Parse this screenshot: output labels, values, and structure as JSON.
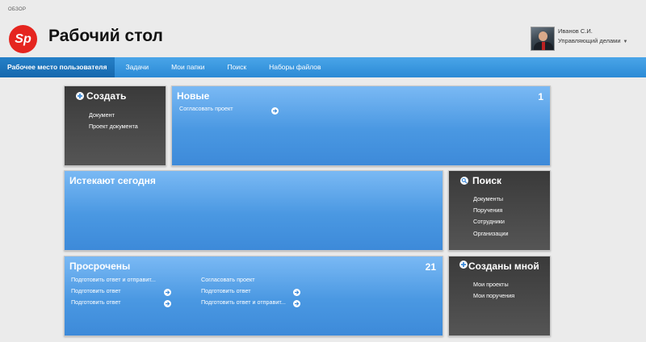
{
  "breadcrumb": "ОБЗОР",
  "logo_text": "Sp",
  "page_title": "Рабочий стол",
  "user": {
    "name": "Иванов С.И.",
    "role": "Управляющий делами"
  },
  "nav": [
    "Рабочее место пользователя",
    "Задачи",
    "Мои папки",
    "Поиск",
    "Наборы файлов"
  ],
  "create": {
    "title": "Создать",
    "items": [
      "Документ",
      "Проект документа"
    ]
  },
  "new_tasks": {
    "title": "Новые",
    "count": "1",
    "items": [
      "Согласовать проект"
    ]
  },
  "expiring": {
    "title": "Истекают сегодня"
  },
  "search": {
    "title": "Поиск",
    "items": [
      "Документы",
      "Поручения",
      "Сотрудники",
      "Организации"
    ]
  },
  "overdue": {
    "title": "Просрочены",
    "count": "21",
    "col1": [
      "Подготовить ответ и отправит...",
      "Подготовить ответ",
      "Подготовить ответ"
    ],
    "col2": [
      "Согласовать проект",
      "Подготовить ответ",
      "Подготовить ответ и отправит..."
    ]
  },
  "created_by_me": {
    "title": "Созданы мной",
    "items": [
      "Мои проекты",
      "Мои поручения"
    ]
  },
  "colors": {
    "accent": "#2b8ad6",
    "tile_blue": "#4a98e2",
    "tile_dark": "#444444",
    "logo": "#e5251f"
  },
  "icons": {
    "create": "plus-circle-icon",
    "search": "magnifier-icon",
    "go": "arrow-right-circle-icon"
  }
}
